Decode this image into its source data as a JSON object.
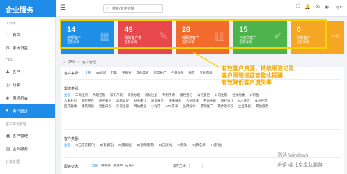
{
  "header": {
    "logo": "企业服务",
    "menu_icon": "menu-icon",
    "search_placeholder": "搜索/文件链接",
    "user": "qdc"
  },
  "sidebar": {
    "section1": "工作单",
    "section2": "CRM",
    "section3": "客户资源管理",
    "section4": "订单管理",
    "items": [
      {
        "label": "首页",
        "icon": "home-icon"
      },
      {
        "label": "系统设置",
        "icon": "gear-icon"
      },
      {
        "label": "客户",
        "icon": "users-icon"
      },
      {
        "label": "线索",
        "icon": "lead-icon"
      },
      {
        "label": "商机机会",
        "icon": "opportunity-icon"
      },
      {
        "label": "客户跟进",
        "icon": "follow-up-icon"
      },
      {
        "label": "客户管理",
        "icon": "contacts-icon"
      },
      {
        "label": "企业服务",
        "icon": "service-icon"
      }
    ]
  },
  "cards": [
    {
      "num": "14",
      "label": "全部客户",
      "sub": "查看详情",
      "color": "#1e8fe6",
      "icon": "clipboard-icon"
    },
    {
      "num": "49",
      "label": "我的客户数",
      "sub": "查看详情",
      "color": "#e8474b",
      "icon": "chat-icon"
    },
    {
      "num": "28",
      "label": "待跟进客户",
      "sub": "查看详情",
      "color": "#f26b2c",
      "icon": "calendar-icon"
    },
    {
      "num": "15",
      "label": "已成交客户",
      "sub": "查看详情",
      "color": "#4db34d",
      "icon": "check-icon"
    },
    {
      "num": "0",
      "label": "失效客户",
      "sub": "查看详情",
      "color": "#f5a623",
      "icon": "exit-icon"
    }
  ],
  "breadcrumb": [
    "CRM",
    "客户管理"
  ],
  "annotation": {
    "line1": "有效客户资源，持续跟进记录",
    "line2": "客户跟进进度智能化提醒",
    "line3": "有效降低客户流失率"
  },
  "filters": {
    "source_label": "客户来源:",
    "source_tags": [
      "全部",
      "58同城",
      "赶集",
      "天眼查",
      "其他渠道",
      "百度推广",
      "今日头条",
      "抖音",
      "专业市场"
    ],
    "industry_label": "需求类别:",
    "industry_tags": [
      "全部",
      "工商注册",
      "代理记账",
      "知识产权",
      "资质办理",
      "商标注册",
      "专利申请",
      "版权登记",
      "公司变更",
      "公司注销",
      "社保代缴",
      "公积金",
      "人事外包",
      "银行开户",
      "税务筹划",
      "高新认证",
      "财务审计",
      "验资报告",
      "法律服务",
      "合同审核",
      "劳动仲裁",
      "股权设计",
      "ICP许可",
      "食品经营",
      "医疗器械",
      "建筑资质",
      "进出口权",
      "外资注册",
      "网站建设",
      "小程序",
      "APP开发",
      "品牌设计",
      "营销推广",
      "软件著作权",
      "企业年报",
      "其他服务"
    ],
    "status_label": "客户类型:",
    "status_tags": [
      "全部",
      "A(已成交客户)",
      "B(有意向)",
      "C(需跟进)",
      "D(暂无需求)",
      "E(已流失)",
      "F(无效)",
      "G(黑名单)",
      "H(其他)"
    ],
    "bottom_label": "跟进状态:",
    "bottom_tags": [
      "全部",
      "待跟进",
      "跟进中",
      "已成交"
    ],
    "sort_label": "排序方式:"
  },
  "watermark": {
    "line1": "激活 Windows",
    "line2": "头条 @北京企业服务"
  }
}
